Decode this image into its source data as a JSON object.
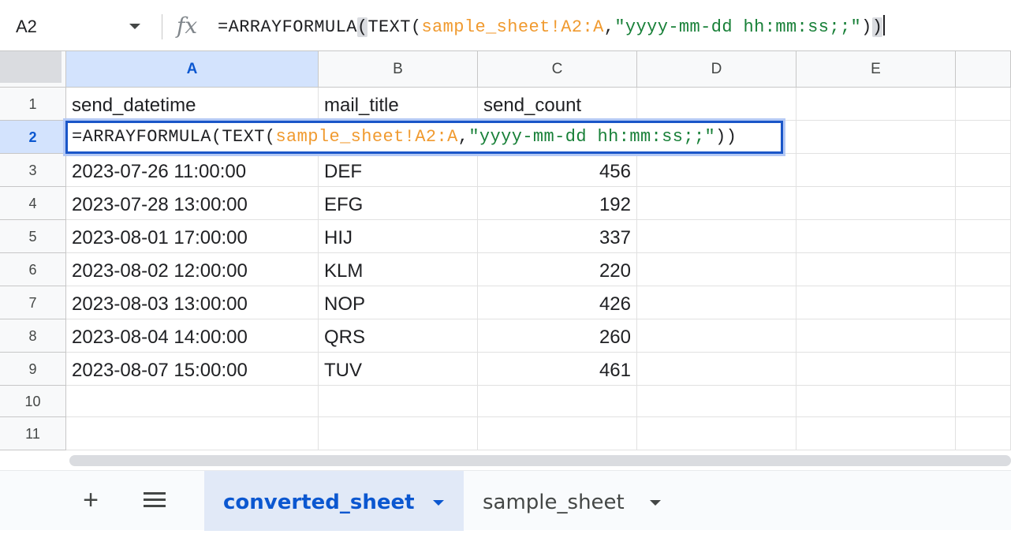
{
  "formula_bar": {
    "cell_ref": "A2",
    "fx_label": "fx",
    "formula": {
      "prefix": "=ARRAYFORMULA",
      "open_paren": "(",
      "fn": "TEXT(",
      "ref": "sample_sheet!A2:A",
      "comma": ",",
      "str": "\"yyyy-mm-dd hh:mm:ss;;\"",
      "close1": ")",
      "close_paren": ")"
    }
  },
  "columns": [
    "A",
    "B",
    "C",
    "D",
    "E"
  ],
  "rows": [
    "1",
    "2",
    "3",
    "4",
    "5",
    "6",
    "7",
    "8",
    "9",
    "10",
    "11"
  ],
  "header_row": [
    "send_datetime",
    "mail_title",
    "send_count"
  ],
  "data_rows": [
    [
      "2023-07-26 11:00:00",
      "DEF",
      "456"
    ],
    [
      "2023-07-28 13:00:00",
      "EFG",
      "192"
    ],
    [
      "2023-08-01 17:00:00",
      "HIJ",
      "337"
    ],
    [
      "2023-08-02 12:00:00",
      "KLM",
      "220"
    ],
    [
      "2023-08-03 13:00:00",
      "NOP",
      "426"
    ],
    [
      "2023-08-04 14:00:00",
      "QRS",
      "260"
    ],
    [
      "2023-08-07 15:00:00",
      "TUV",
      "461"
    ]
  ],
  "editor": {
    "fn": "=ARRAYFORMULA(TEXT(",
    "ref": "sample_sheet!A2:A",
    "comma": ",",
    "str": "\"yyyy-mm-dd hh:mm:ss;;\"",
    "close": "))"
  },
  "tabs": {
    "add_label": "+",
    "sheets": [
      "converted_sheet",
      "sample_sheet"
    ],
    "active": "converted_sheet"
  },
  "colors": {
    "selection": "#1a56c8",
    "reference": "#f09a2f",
    "string": "#188038",
    "active_tab": "#0b57d0"
  }
}
